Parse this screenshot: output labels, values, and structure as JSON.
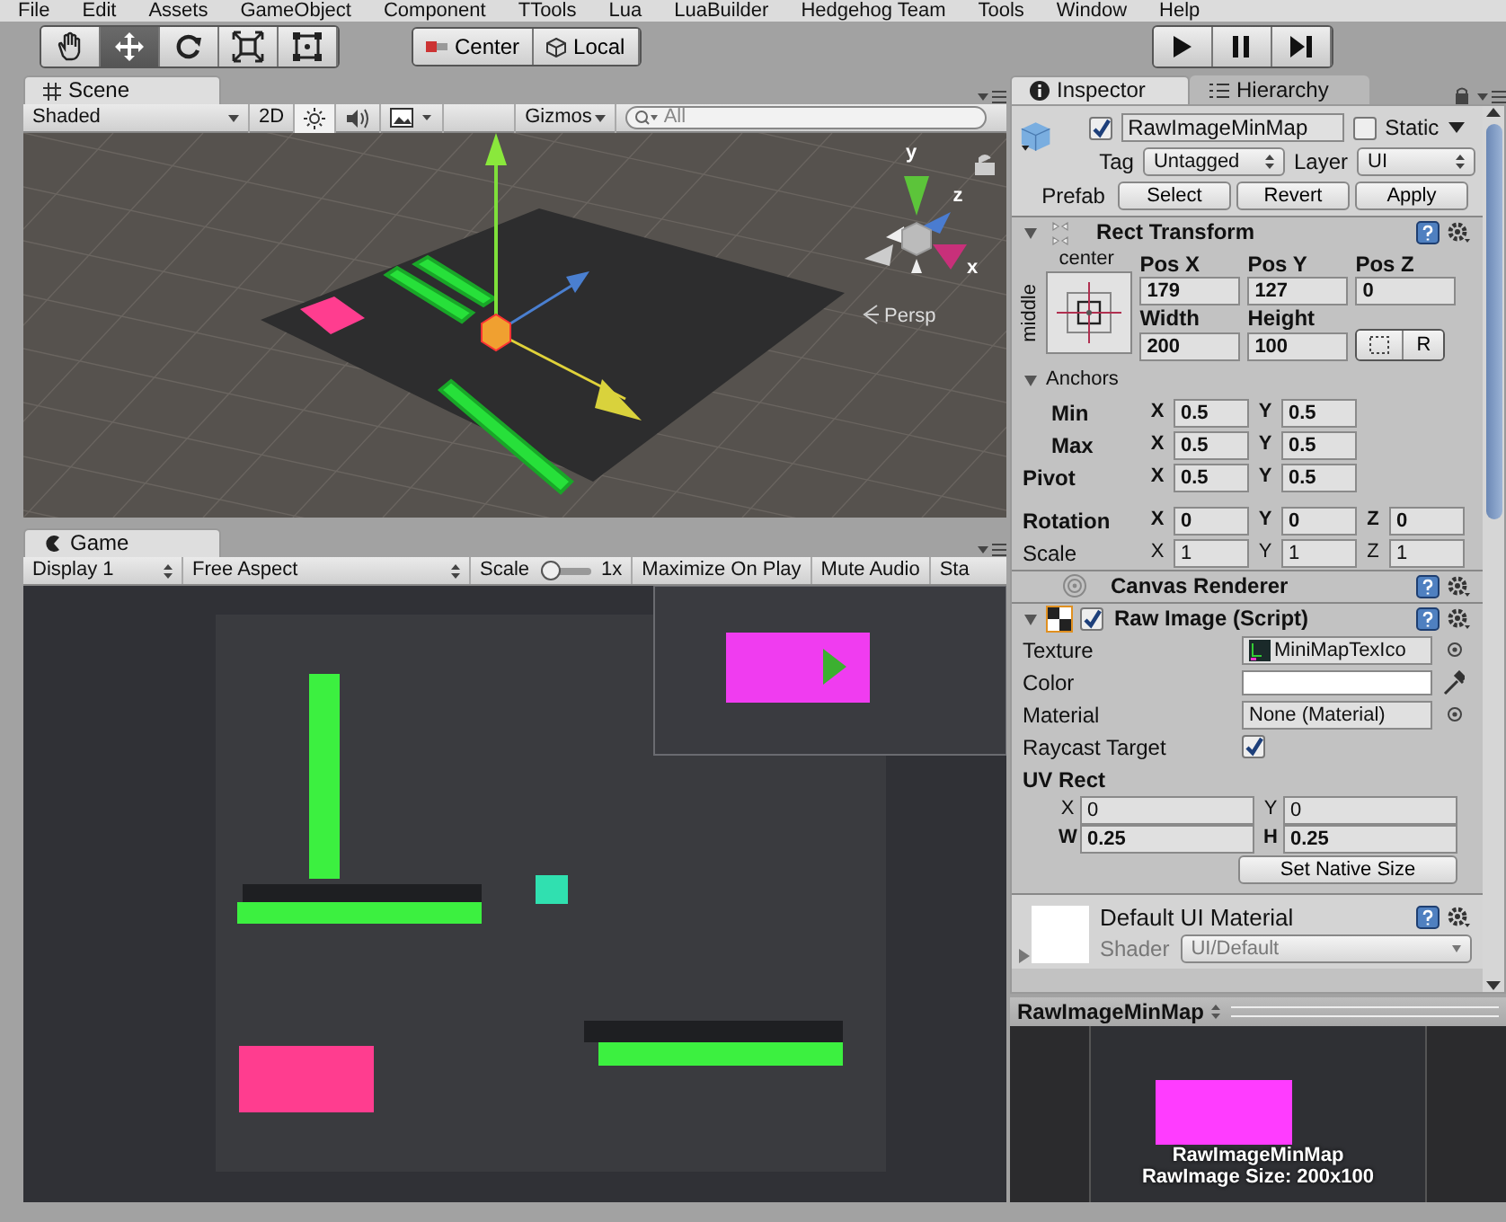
{
  "menu_bar": [
    "File",
    "Edit",
    "Assets",
    "GameObject",
    "Component",
    "TTools",
    "Lua",
    "LuaBuilder",
    "Hedgehog Team",
    "Tools",
    "Window",
    "Help"
  ],
  "toolbar": {
    "tools": [
      {
        "kind": "hand",
        "selected": false
      },
      {
        "kind": "move",
        "selected": true
      },
      {
        "kind": "rotate",
        "selected": false
      },
      {
        "kind": "scale",
        "selected": false
      },
      {
        "kind": "rect",
        "selected": false
      }
    ],
    "pivot_buttons": [
      {
        "kind": "pivot",
        "label": "Center"
      },
      {
        "kind": "space",
        "label": "Local"
      }
    ],
    "play_buttons": [
      {
        "kind": "play"
      },
      {
        "kind": "pause"
      },
      {
        "kind": "step"
      }
    ]
  },
  "scene": {
    "tab": "Scene",
    "shading": "Shaded",
    "mode_2d": "2D",
    "lighting_on": true,
    "audio_on": false,
    "gizmos": "Gizmos",
    "search_placeholder": "All",
    "axis_labels": [
      "y",
      "z",
      "x"
    ],
    "projection": "Persp"
  },
  "game": {
    "tab": "Game",
    "display": "Display 1",
    "aspect": "Free Aspect",
    "scale": {
      "label": "Scale",
      "level": 0,
      "reading": "1x"
    },
    "buttons": [
      "Maximize On Play",
      "Mute Audio",
      "Sta"
    ]
  },
  "inspector": {
    "tabs": [
      {
        "label": "Inspector",
        "selected": true
      },
      {
        "label": "Hierarchy",
        "selected": false
      }
    ],
    "object": {
      "active": true,
      "name": "RawImageMinMap",
      "static": false,
      "static_label": "Static",
      "tag_label": "Tag",
      "tag": "Untagged",
      "layer_label": "Layer",
      "layer": "UI",
      "prefab_label": "Prefab",
      "prefab_buttons": [
        "Select",
        "Revert",
        "Apply"
      ]
    },
    "rect_transform": {
      "title": "Rect Transform",
      "expanded": true,
      "anchor_h": "center",
      "anchor_v": "middle",
      "fields": [
        {
          "label": "Pos X",
          "value": "179"
        },
        {
          "label": "Pos Y",
          "value": "127"
        },
        {
          "label": "Pos Z",
          "value": "0"
        },
        {
          "label": "Width",
          "value": "200"
        },
        {
          "label": "Height",
          "value": "100"
        }
      ],
      "raw_button": "R",
      "anchors": {
        "label": "Anchors",
        "expanded": true,
        "rows": [
          {
            "label": "Min",
            "fields": [
              {
                "axis": "X",
                "value": "0.5"
              },
              {
                "axis": "Y",
                "value": "0.5"
              }
            ]
          },
          {
            "label": "Max",
            "fields": [
              {
                "axis": "X",
                "value": "0.5"
              },
              {
                "axis": "Y",
                "value": "0.5"
              }
            ]
          }
        ]
      },
      "pivot": {
        "label": "Pivot",
        "fields": [
          {
            "axis": "X",
            "value": "0.5"
          },
          {
            "axis": "Y",
            "value": "0.5"
          }
        ]
      },
      "rotation": {
        "label": "Rotation",
        "fields": [
          {
            "axis": "X",
            "value": "0"
          },
          {
            "axis": "Y",
            "value": "0"
          },
          {
            "axis": "Z",
            "value": "0"
          }
        ]
      },
      "scale": {
        "label": "Scale",
        "fields": [
          {
            "axis": "X",
            "value": "1"
          },
          {
            "axis": "Y",
            "value": "1"
          },
          {
            "axis": "Z",
            "value": "1"
          }
        ]
      }
    },
    "canvas_renderer": {
      "title": "Canvas Renderer"
    },
    "raw_image": {
      "title": "Raw Image (Script)",
      "enabled": true,
      "expanded": true,
      "properties": [
        {
          "kind": "object",
          "label": "Texture",
          "value": "MiniMapTexIco"
        },
        {
          "kind": "color",
          "label": "Color",
          "color": "#ffffff"
        },
        {
          "kind": "object",
          "label": "Material",
          "value": "None (Material)"
        },
        {
          "kind": "check",
          "label": "Raycast Target",
          "checked": true
        }
      ],
      "uv_rect": {
        "label": "UV Rect",
        "fields": [
          {
            "axis": "X",
            "value": "0"
          },
          {
            "axis": "Y",
            "value": "0"
          },
          {
            "axis": "W",
            "value": "0.25"
          },
          {
            "axis": "H",
            "value": "0.25"
          }
        ]
      },
      "button": "Set Native Size"
    },
    "material": {
      "name": "Default UI Material",
      "shader_label": "Shader",
      "shader": "UI/Default"
    }
  },
  "preview": {
    "title": "RawImageMinMap",
    "caption": [
      "RawImageMinMap",
      "RawImage Size: 200x100"
    ]
  }
}
